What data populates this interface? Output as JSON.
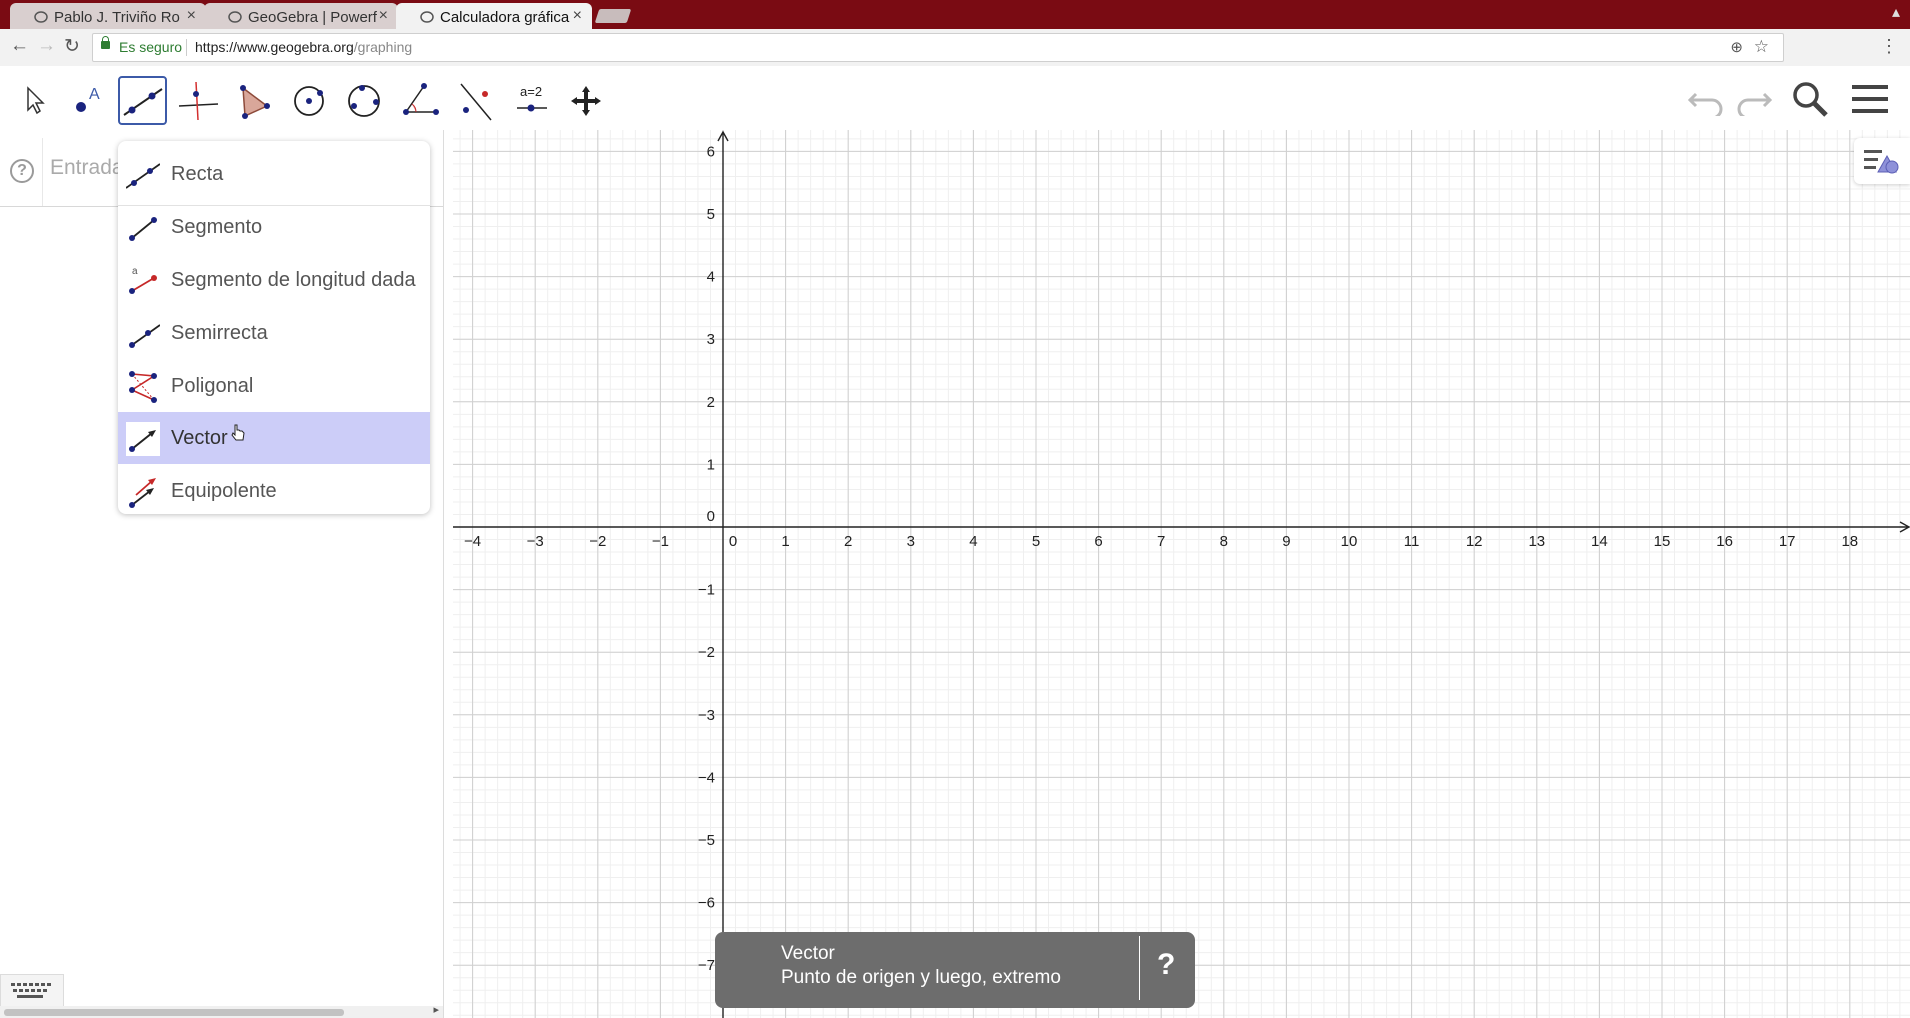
{
  "browser": {
    "tabs": [
      {
        "label": "Pablo J. Triviño Ro",
        "active": false
      },
      {
        "label": "GeoGebra | Powerf",
        "active": false
      },
      {
        "label": "Calculadora gráfica",
        "active": true
      }
    ],
    "security_label": "Es seguro",
    "url_host": "https://www.geogebra.org",
    "url_path": "/graphing"
  },
  "toolbar": {
    "tools": [
      {
        "name": "move-tool-icon"
      },
      {
        "name": "point-tool-icon"
      },
      {
        "name": "line-tool-icon",
        "selected": true
      },
      {
        "name": "perpendicular-tool-icon"
      },
      {
        "name": "polygon-tool-icon"
      },
      {
        "name": "circle-tool-icon"
      },
      {
        "name": "conic-tool-icon"
      },
      {
        "name": "angle-tool-icon"
      },
      {
        "name": "reflect-tool-icon"
      },
      {
        "name": "slider-tool-icon",
        "label": "a=2"
      },
      {
        "name": "move-graphics-tool-icon"
      }
    ]
  },
  "algebra": {
    "input_placeholder": "Entrada"
  },
  "dropdown": {
    "items": [
      {
        "label": "Recta",
        "icon": "line-icon"
      },
      {
        "label": "Segmento",
        "icon": "segment-icon"
      },
      {
        "label": "Segmento de longitud dada",
        "icon": "segment-fixed-length-icon"
      },
      {
        "label": "Semirrecta",
        "icon": "ray-icon"
      },
      {
        "label": "Poligonal",
        "icon": "polyline-icon"
      },
      {
        "label": "Vector",
        "icon": "vector-icon",
        "highlighted": true
      },
      {
        "label": "Equipolente",
        "icon": "vector-from-point-icon"
      }
    ]
  },
  "graph": {
    "x_ticks": [
      "−4",
      "−3",
      "−2",
      "−1",
      "0",
      "1",
      "2",
      "3",
      "4",
      "5",
      "6",
      "7",
      "8",
      "9",
      "10",
      "11",
      "12",
      "13",
      "14",
      "15",
      "16",
      "17",
      "18"
    ],
    "y_ticks_positive": [
      "6",
      "5",
      "4",
      "3",
      "2",
      "1",
      "0"
    ],
    "y_ticks_negative": [
      "−1",
      "−2",
      "−3",
      "−4",
      "−5",
      "−6",
      "−7"
    ],
    "x_range": [
      -4,
      18
    ],
    "y_range": [
      -7,
      6
    ],
    "grid": true
  },
  "tooltip": {
    "title": "Vector",
    "description": "Punto de origen y luego, extremo",
    "help_label": "?"
  },
  "colors": {
    "tab_bar": "#7a0b13",
    "selection": "#cccdf8",
    "tool_border": "#3c5aa8",
    "tooltip_bg": "#6d6d6d"
  }
}
